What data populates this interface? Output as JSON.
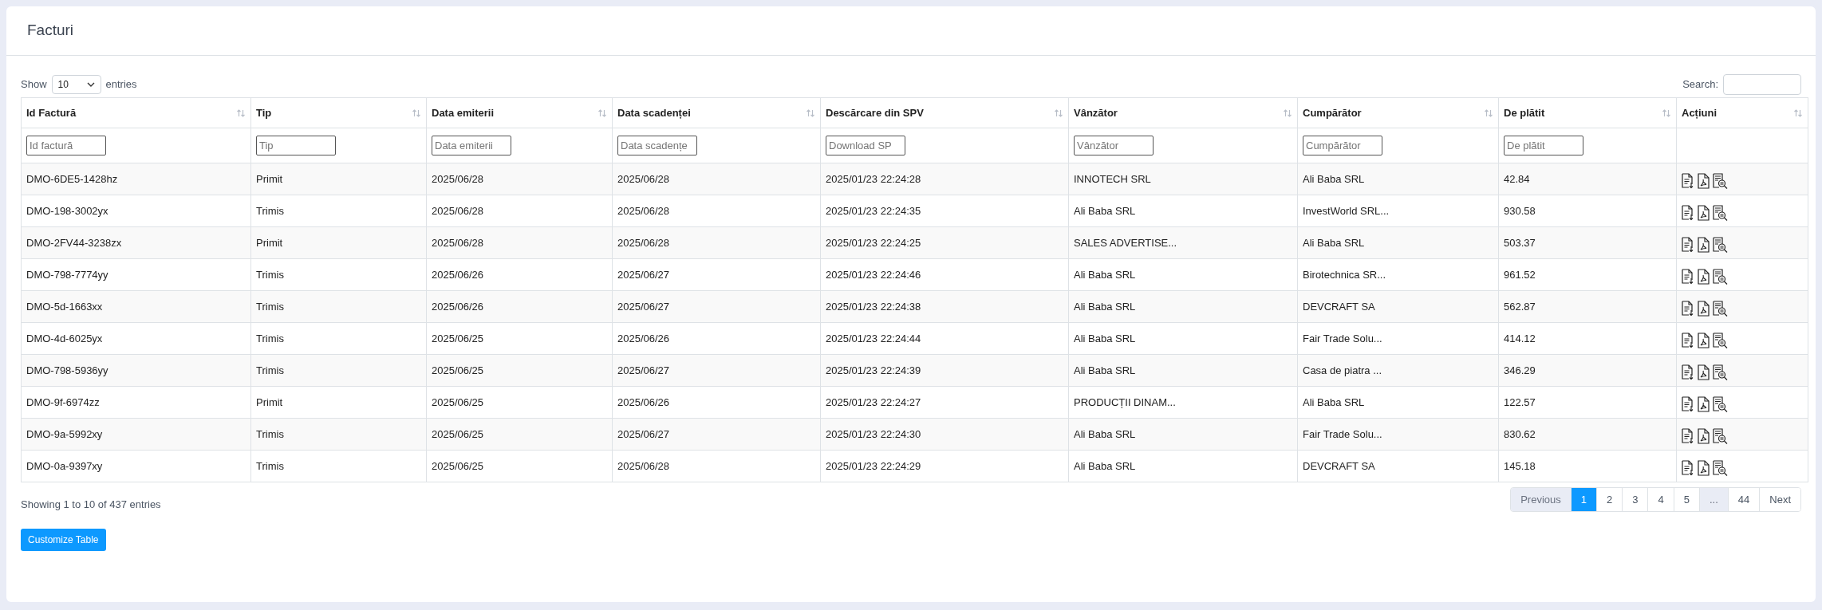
{
  "card": {
    "title": "Facturi"
  },
  "length_menu": {
    "before": "Show",
    "value": "10",
    "after": "entries"
  },
  "search": {
    "label": "Search:"
  },
  "table": {
    "columns": [
      {
        "label": "Id Factură",
        "filter_placeholder": "Id factură"
      },
      {
        "label": "Tip",
        "filter_placeholder": "Tip"
      },
      {
        "label": "Data emiterii",
        "filter_placeholder": "Data emiterii"
      },
      {
        "label": "Data scadenței",
        "filter_placeholder": "Data scadențe"
      },
      {
        "label": "Descărcare din SPV",
        "filter_placeholder": "Download SP"
      },
      {
        "label": "Vânzător",
        "filter_placeholder": "Vânzător"
      },
      {
        "label": "Cumpărător",
        "filter_placeholder": "Cumpărător"
      },
      {
        "label": "De plătit",
        "filter_placeholder": "De plătit"
      },
      {
        "label": "Acțiuni"
      }
    ],
    "rows": [
      [
        "DMO-6DE5-1428hz",
        "Primit",
        "2025/06/28",
        "2025/06/28",
        "2025/01/23 22:24:28",
        "INNOTECH SRL",
        "Ali Baba SRL",
        "42.84"
      ],
      [
        "DMO-198-3002yx",
        "Trimis",
        "2025/06/28",
        "2025/06/28",
        "2025/01/23 22:24:35",
        "Ali Baba SRL",
        "InvestWorld SRL...",
        "930.58"
      ],
      [
        "DMO-2FV44-3238zx",
        "Primit",
        "2025/06/28",
        "2025/06/28",
        "2025/01/23 22:24:25",
        "SALES ADVERTISE...",
        "Ali Baba SRL",
        "503.37"
      ],
      [
        "DMO-798-7774yy",
        "Trimis",
        "2025/06/26",
        "2025/06/27",
        "2025/01/23 22:24:46",
        "Ali Baba SRL",
        "Birotechnica SR...",
        "961.52"
      ],
      [
        "DMO-5d-1663xx",
        "Trimis",
        "2025/06/26",
        "2025/06/27",
        "2025/01/23 22:24:38",
        "Ali Baba SRL",
        "DEVCRAFT SA",
        "562.87"
      ],
      [
        "DMO-4d-6025yx",
        "Trimis",
        "2025/06/25",
        "2025/06/26",
        "2025/01/23 22:24:44",
        "Ali Baba SRL",
        "Fair Trade Solu...",
        "414.12"
      ],
      [
        "DMO-798-5936yy",
        "Trimis",
        "2025/06/25",
        "2025/06/27",
        "2025/01/23 22:24:39",
        "Ali Baba SRL",
        "Casa de piatra ...",
        "346.29"
      ],
      [
        "DMO-9f-6974zz",
        "Primit",
        "2025/06/25",
        "2025/06/26",
        "2025/01/23 22:24:27",
        "PRODUCȚII DINAM...",
        "Ali Baba SRL",
        "122.57"
      ],
      [
        "DMO-9a-5992xy",
        "Trimis",
        "2025/06/25",
        "2025/06/27",
        "2025/01/23 22:24:30",
        "Ali Baba SRL",
        "Fair Trade Solu...",
        "830.62"
      ],
      [
        "DMO-0a-9397xy",
        "Trimis",
        "2025/06/25",
        "2025/06/28",
        "2025/01/23 22:24:29",
        "Ali Baba SRL",
        "DEVCRAFT SA",
        "145.18"
      ]
    ]
  },
  "info": "Showing 1 to 10 of 437 entries",
  "pagination": [
    {
      "label": "Previous",
      "selected": false,
      "disabled": true
    },
    {
      "label": "1",
      "selected": true,
      "disabled": false
    },
    {
      "label": "2",
      "selected": false,
      "disabled": false
    },
    {
      "label": "3",
      "selected": false,
      "disabled": false
    },
    {
      "label": "4",
      "selected": false,
      "disabled": false
    },
    {
      "label": "5",
      "selected": false,
      "disabled": false
    },
    {
      "label": "...",
      "selected": false,
      "disabled": true
    },
    {
      "label": "44",
      "selected": false,
      "disabled": false
    },
    {
      "label": "Next",
      "selected": false,
      "disabled": false
    }
  ],
  "customize_button": "Customize Table"
}
